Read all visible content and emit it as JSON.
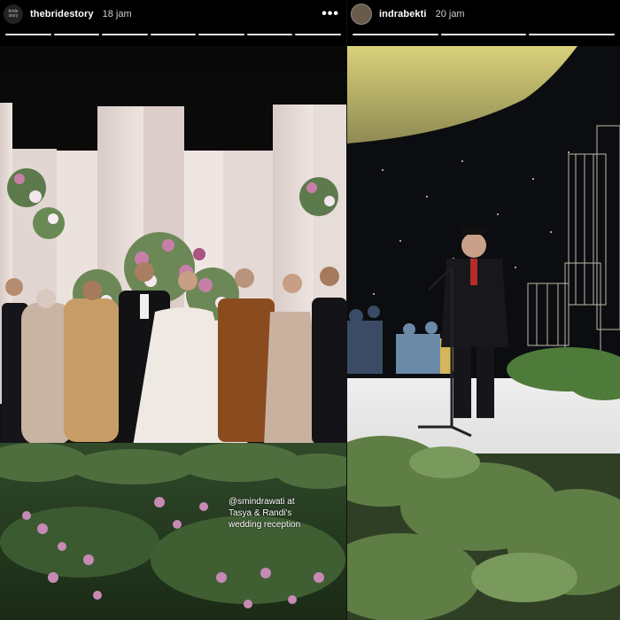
{
  "stories": [
    {
      "username": "thebridestory",
      "time": "18 jam",
      "avatar_text": "bride story",
      "more_glyph": "•••",
      "caption_lines": [
        "@smindrawati at",
        "Tasya & Randi's",
        "wedding reception"
      ],
      "progress": {
        "segments": 7,
        "done": 7
      }
    },
    {
      "username": "indrabekti",
      "time": "20 jam",
      "progress": {
        "segments": 3,
        "done": 3
      }
    }
  ],
  "colors": {
    "accent_bar": "#e8e8e8",
    "bar_bg": "#6b6b6b"
  },
  "icons": {
    "more": "more-options-icon"
  }
}
